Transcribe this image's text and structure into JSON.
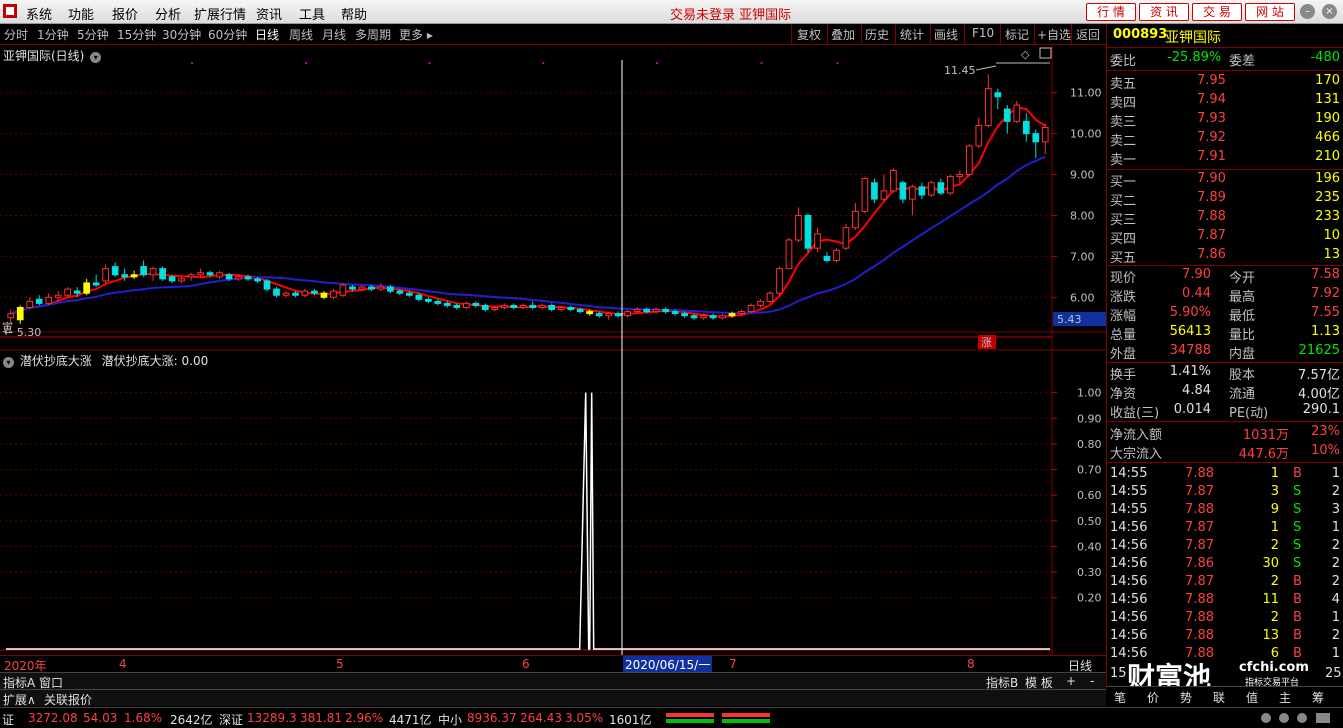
{
  "menubar": {
    "items": [
      "系统",
      "功能",
      "报价",
      "分析",
      "扩展行情",
      "资讯",
      "工具",
      "帮助"
    ],
    "status_title": "交易未登录 亚钾国际",
    "buttons": [
      "行 情",
      "资 讯",
      "交 易",
      "网 站"
    ]
  },
  "toolbar": {
    "periods": [
      "分时",
      "1分钟",
      "5分钟",
      "15分钟",
      "30分钟",
      "60分钟",
      "日线",
      "周线",
      "月线",
      "多周期",
      "更多 ▸"
    ],
    "active_period": "日线",
    "tools": [
      "复权",
      "叠加",
      "历史",
      "统计",
      "画线",
      "F10",
      "标记",
      "+自选",
      "返回"
    ]
  },
  "chart": {
    "title": "亚钾国际(日线)",
    "y_ticks": [
      "11.00",
      "10.00",
      "9.00",
      "8.00",
      "7.00",
      "6.00"
    ],
    "current_price_tag": "5.43",
    "high_annotation": "11.45",
    "low_annotation": "← 5.30",
    "overlay_text": "寅",
    "rise_marker": "涨",
    "x_labels": [
      "2020年",
      "4",
      "5",
      "6",
      "7",
      "8"
    ],
    "cursor_date": "2020/06/15/一",
    "period_label": "日线"
  },
  "indicator": {
    "title": "潜伏抄底大涨",
    "value_text": "潜伏抄底大涨: 0.00",
    "y_ticks": [
      "1.00",
      "0.90",
      "0.80",
      "0.70",
      "0.60",
      "0.50",
      "0.40",
      "0.30",
      "0.20"
    ]
  },
  "quote": {
    "code": "000893",
    "name": "亚钾国际",
    "weibi_label": "委比",
    "weibi": "-25.89%",
    "weicha_label": "委差",
    "weicha": "-480",
    "asks": [
      {
        "label": "卖五",
        "price": "7.95",
        "vol": "170"
      },
      {
        "label": "卖四",
        "price": "7.94",
        "vol": "131"
      },
      {
        "label": "卖三",
        "price": "7.93",
        "vol": "190"
      },
      {
        "label": "卖二",
        "price": "7.92",
        "vol": "466"
      },
      {
        "label": "卖一",
        "price": "7.91",
        "vol": "210"
      }
    ],
    "bids": [
      {
        "label": "买一",
        "price": "7.90",
        "vol": "196"
      },
      {
        "label": "买二",
        "price": "7.89",
        "vol": "235"
      },
      {
        "label": "买三",
        "price": "7.88",
        "vol": "233"
      },
      {
        "label": "买四",
        "price": "7.87",
        "vol": "10"
      },
      {
        "label": "买五",
        "price": "7.86",
        "vol": "13"
      }
    ],
    "stats": [
      {
        "l1": "现价",
        "v1": "7.90",
        "l2": "今开",
        "v2": "7.58"
      },
      {
        "l1": "涨跌",
        "v1": "0.44",
        "l2": "最高",
        "v2": "7.92"
      },
      {
        "l1": "涨幅",
        "v1": "5.90%",
        "l2": "最低",
        "v2": "7.55"
      },
      {
        "l1": "总量",
        "v1": "56413",
        "l2": "量比",
        "v2": "1.13"
      },
      {
        "l1": "外盘",
        "v1": "34788",
        "l2": "内盘",
        "v2": "21625"
      }
    ],
    "fund": [
      {
        "l1": "换手",
        "v1": "1.41%",
        "l2": "股本",
        "v2": "7.57亿"
      },
      {
        "l1": "净资",
        "v1": "4.84",
        "l2": "流通",
        "v2": "4.00亿"
      },
      {
        "l1": "收益(三)",
        "v1": "0.014",
        "l2": "PE(动)",
        "v2": "290.1"
      }
    ],
    "flows": [
      {
        "label": "净流入额",
        "value": "1031万",
        "pct": "23%"
      },
      {
        "label": "大宗流入",
        "value": "447.6万",
        "pct": "10%"
      }
    ],
    "ticks": [
      {
        "t": "14:55",
        "p": "7.88",
        "v": "1",
        "s": "B",
        "n": "1"
      },
      {
        "t": "14:55",
        "p": "7.87",
        "v": "3",
        "s": "S",
        "n": "2"
      },
      {
        "t": "14:55",
        "p": "7.88",
        "v": "9",
        "s": "S",
        "n": "3"
      },
      {
        "t": "14:56",
        "p": "7.87",
        "v": "1",
        "s": "S",
        "n": "1"
      },
      {
        "t": "14:56",
        "p": "7.87",
        "v": "2",
        "s": "S",
        "n": "2"
      },
      {
        "t": "14:56",
        "p": "7.86",
        "v": "30",
        "s": "S",
        "n": "2"
      },
      {
        "t": "14:56",
        "p": "7.87",
        "v": "2",
        "s": "B",
        "n": "2"
      },
      {
        "t": "14:56",
        "p": "7.88",
        "v": "11",
        "s": "B",
        "n": "4"
      },
      {
        "t": "14:56",
        "p": "7.88",
        "v": "2",
        "s": "B",
        "n": "1"
      },
      {
        "t": "14:56",
        "p": "7.88",
        "v": "13",
        "s": "B",
        "n": "2"
      },
      {
        "t": "14:56",
        "p": "7.88",
        "v": "6",
        "s": "B",
        "n": "1"
      }
    ],
    "last_tick_time": "15",
    "last_tick_n": "25",
    "bottom_tabs": [
      "笔",
      "价",
      "势",
      "联",
      "值",
      "主",
      "筹"
    ],
    "watermark": "财富池",
    "watermark_sub": "cfchi.com",
    "watermark_caption": "指标交易平台"
  },
  "tabs": {
    "row1": [
      "指标A",
      "窗口"
    ],
    "row1_right": [
      "指标B",
      "模 板",
      "+",
      "-"
    ],
    "row2": [
      "扩展∧",
      "关联报价"
    ]
  },
  "index_bar": [
    {
      "name": "证",
      "price": "3272.08",
      "chg": "54.03",
      "pct": "1.68%",
      "amt": "2642亿"
    },
    {
      "name": "深证",
      "price": "13289.3",
      "chg": "381.81",
      "pct": "2.96%",
      "amt": "4471亿"
    },
    {
      "name": "中小",
      "price": "8936.37",
      "chg": "264.43",
      "pct": "3.05%",
      "amt": "1601亿"
    }
  ],
  "chart_data": {
    "type": "candlestick",
    "candles": [
      {
        "o": 5.5,
        "c": 5.6,
        "h": 5.7,
        "l": 5.35
      },
      {
        "o": 5.45,
        "c": 5.75,
        "h": 5.8,
        "l": 5.35
      },
      {
        "o": 5.75,
        "c": 5.9,
        "h": 6.0,
        "l": 5.7
      },
      {
        "o": 5.95,
        "c": 5.85,
        "h": 6.05,
        "l": 5.8
      },
      {
        "o": 5.85,
        "c": 6.0,
        "h": 6.1,
        "l": 5.8
      },
      {
        "o": 6.0,
        "c": 6.05,
        "h": 6.15,
        "l": 5.9
      },
      {
        "o": 6.05,
        "c": 6.2,
        "h": 6.25,
        "l": 6.0
      },
      {
        "o": 6.15,
        "c": 6.1,
        "h": 6.25,
        "l": 6.0
      },
      {
        "o": 6.1,
        "c": 6.35,
        "h": 6.45,
        "l": 6.05
      },
      {
        "o": 6.35,
        "c": 6.3,
        "h": 6.55,
        "l": 6.25
      },
      {
        "o": 6.4,
        "c": 6.7,
        "h": 6.8,
        "l": 6.35
      },
      {
        "o": 6.75,
        "c": 6.55,
        "h": 6.85,
        "l": 6.5
      },
      {
        "o": 6.55,
        "c": 6.5,
        "h": 6.7,
        "l": 6.4
      },
      {
        "o": 6.5,
        "c": 6.55,
        "h": 6.65,
        "l": 6.45
      },
      {
        "o": 6.75,
        "c": 6.55,
        "h": 6.9,
        "l": 6.5
      },
      {
        "o": 6.55,
        "c": 6.7,
        "h": 6.75,
        "l": 6.4
      },
      {
        "o": 6.7,
        "c": 6.45,
        "h": 6.75,
        "l": 6.4
      },
      {
        "o": 6.5,
        "c": 6.4,
        "h": 6.55,
        "l": 6.35
      },
      {
        "o": 6.4,
        "c": 6.45,
        "h": 6.5,
        "l": 6.35
      },
      {
        "o": 6.5,
        "c": 6.55,
        "h": 6.6,
        "l": 6.4
      },
      {
        "o": 6.55,
        "c": 6.6,
        "h": 6.7,
        "l": 6.5
      },
      {
        "o": 6.6,
        "c": 6.55,
        "h": 6.65,
        "l": 6.5
      },
      {
        "o": 6.5,
        "c": 6.6,
        "h": 6.65,
        "l": 6.45
      },
      {
        "o": 6.55,
        "c": 6.45,
        "h": 6.6,
        "l": 6.4
      },
      {
        "o": 6.45,
        "c": 6.5,
        "h": 6.55,
        "l": 6.4
      },
      {
        "o": 6.5,
        "c": 6.45,
        "h": 6.55,
        "l": 6.4
      },
      {
        "o": 6.45,
        "c": 6.4,
        "h": 6.5,
        "l": 6.35
      },
      {
        "o": 6.4,
        "c": 6.2,
        "h": 6.45,
        "l": 6.15
      },
      {
        "o": 6.2,
        "c": 6.05,
        "h": 6.25,
        "l": 6.0
      },
      {
        "o": 6.05,
        "c": 6.1,
        "h": 6.15,
        "l": 6.0
      },
      {
        "o": 6.1,
        "c": 6.05,
        "h": 6.15,
        "l": 6.0
      },
      {
        "o": 6.05,
        "c": 6.15,
        "h": 6.2,
        "l": 6.0
      },
      {
        "o": 6.15,
        "c": 6.1,
        "h": 6.2,
        "l": 6.05
      },
      {
        "o": 6.1,
        "c": 6.0,
        "h": 6.15,
        "l": 5.95
      },
      {
        "o": 6.0,
        "c": 6.15,
        "h": 6.2,
        "l": 5.95
      },
      {
        "o": 6.05,
        "c": 6.3,
        "h": 6.35,
        "l": 6.0
      },
      {
        "o": 6.25,
        "c": 6.2,
        "h": 6.3,
        "l": 6.15
      },
      {
        "o": 6.2,
        "c": 6.25,
        "h": 6.3,
        "l": 6.15
      },
      {
        "o": 6.25,
        "c": 6.2,
        "h": 6.3,
        "l": 6.15
      },
      {
        "o": 6.2,
        "c": 6.25,
        "h": 6.35,
        "l": 6.15
      },
      {
        "o": 6.25,
        "c": 6.15,
        "h": 6.3,
        "l": 6.1
      },
      {
        "o": 6.15,
        "c": 6.1,
        "h": 6.2,
        "l": 6.05
      },
      {
        "o": 6.1,
        "c": 6.05,
        "h": 6.15,
        "l": 6.0
      },
      {
        "o": 6.05,
        "c": 5.95,
        "h": 6.1,
        "l": 5.9
      },
      {
        "o": 5.95,
        "c": 5.9,
        "h": 6.0,
        "l": 5.85
      },
      {
        "o": 5.9,
        "c": 5.85,
        "h": 5.95,
        "l": 5.8
      },
      {
        "o": 5.85,
        "c": 5.8,
        "h": 5.9,
        "l": 5.75
      },
      {
        "o": 5.8,
        "c": 5.75,
        "h": 5.85,
        "l": 5.7
      },
      {
        "o": 5.75,
        "c": 5.85,
        "h": 5.9,
        "l": 5.7
      },
      {
        "o": 5.85,
        "c": 5.8,
        "h": 5.9,
        "l": 5.75
      },
      {
        "o": 5.8,
        "c": 5.7,
        "h": 5.85,
        "l": 5.65
      },
      {
        "o": 5.7,
        "c": 5.75,
        "h": 5.8,
        "l": 5.65
      },
      {
        "o": 5.75,
        "c": 5.8,
        "h": 5.85,
        "l": 5.7
      },
      {
        "o": 5.8,
        "c": 5.75,
        "h": 5.85,
        "l": 5.7
      },
      {
        "o": 5.75,
        "c": 5.8,
        "h": 5.85,
        "l": 5.7
      },
      {
        "o": 5.8,
        "c": 5.75,
        "h": 5.9,
        "l": 5.7
      },
      {
        "o": 5.75,
        "c": 5.8,
        "h": 5.85,
        "l": 5.7
      },
      {
        "o": 5.8,
        "c": 5.7,
        "h": 5.85,
        "l": 5.65
      },
      {
        "o": 5.7,
        "c": 5.75,
        "h": 5.8,
        "l": 5.65
      },
      {
        "o": 5.75,
        "c": 5.7,
        "h": 5.8,
        "l": 5.65
      },
      {
        "o": 5.7,
        "c": 5.65,
        "h": 5.75,
        "l": 5.6
      },
      {
        "o": 5.65,
        "c": 5.6,
        "h": 5.7,
        "l": 5.55
      },
      {
        "o": 5.6,
        "c": 5.55,
        "h": 5.65,
        "l": 5.5
      },
      {
        "o": 5.55,
        "c": 5.6,
        "h": 5.65,
        "l": 5.45
      },
      {
        "o": 5.6,
        "c": 5.55,
        "h": 5.65,
        "l": 5.5
      },
      {
        "o": 5.55,
        "c": 5.65,
        "h": 5.7,
        "l": 5.5
      },
      {
        "o": 5.65,
        "c": 5.7,
        "h": 5.75,
        "l": 5.6
      },
      {
        "o": 5.7,
        "c": 5.65,
        "h": 5.75,
        "l": 5.6
      },
      {
        "o": 5.65,
        "c": 5.7,
        "h": 5.75,
        "l": 5.6
      },
      {
        "o": 5.7,
        "c": 5.65,
        "h": 5.75,
        "l": 5.6
      },
      {
        "o": 5.65,
        "c": 5.6,
        "h": 5.7,
        "l": 5.55
      },
      {
        "o": 5.6,
        "c": 5.55,
        "h": 5.65,
        "l": 5.5
      },
      {
        "o": 5.55,
        "c": 5.5,
        "h": 5.6,
        "l": 5.45
      },
      {
        "o": 5.5,
        "c": 5.55,
        "h": 5.6,
        "l": 5.45
      },
      {
        "o": 5.55,
        "c": 5.5,
        "h": 5.6,
        "l": 5.45
      },
      {
        "o": 5.5,
        "c": 5.55,
        "h": 5.6,
        "l": 5.45
      },
      {
        "o": 5.55,
        "c": 5.6,
        "h": 5.65,
        "l": 5.5
      },
      {
        "o": 5.6,
        "c": 5.65,
        "h": 5.7,
        "l": 5.55
      },
      {
        "o": 5.65,
        "c": 5.8,
        "h": 5.85,
        "l": 5.6
      },
      {
        "o": 5.8,
        "c": 5.9,
        "h": 5.95,
        "l": 5.75
      },
      {
        "o": 5.9,
        "c": 6.1,
        "h": 6.15,
        "l": 5.85
      },
      {
        "o": 6.1,
        "c": 6.7,
        "h": 6.75,
        "l": 6.05
      },
      {
        "o": 6.7,
        "c": 7.4,
        "h": 7.45,
        "l": 6.7
      },
      {
        "o": 7.4,
        "c": 8.0,
        "h": 8.2,
        "l": 7.35
      },
      {
        "o": 8.0,
        "c": 7.2,
        "h": 8.05,
        "l": 7.1
      },
      {
        "o": 7.2,
        "c": 7.55,
        "h": 7.7,
        "l": 7.1
      },
      {
        "o": 7.0,
        "c": 6.9,
        "h": 7.1,
        "l": 6.85
      },
      {
        "o": 6.9,
        "c": 7.15,
        "h": 7.2,
        "l": 6.85
      },
      {
        "o": 7.2,
        "c": 7.7,
        "h": 7.8,
        "l": 7.15
      },
      {
        "o": 7.7,
        "c": 8.1,
        "h": 8.3,
        "l": 7.65
      },
      {
        "o": 8.1,
        "c": 8.9,
        "h": 8.95,
        "l": 8.05
      },
      {
        "o": 8.8,
        "c": 8.4,
        "h": 8.9,
        "l": 8.3
      },
      {
        "o": 8.4,
        "c": 8.6,
        "h": 9.0,
        "l": 8.35
      },
      {
        "o": 8.6,
        "c": 9.1,
        "h": 9.15,
        "l": 8.55
      },
      {
        "o": 8.8,
        "c": 8.4,
        "h": 8.85,
        "l": 8.3
      },
      {
        "o": 8.4,
        "c": 8.7,
        "h": 8.75,
        "l": 8.0
      },
      {
        "o": 8.7,
        "c": 8.5,
        "h": 8.8,
        "l": 8.4
      },
      {
        "o": 8.5,
        "c": 8.8,
        "h": 8.85,
        "l": 8.45
      },
      {
        "o": 8.8,
        "c": 8.55,
        "h": 8.9,
        "l": 8.5
      },
      {
        "o": 8.55,
        "c": 8.95,
        "h": 9.0,
        "l": 8.5
      },
      {
        "o": 8.95,
        "c": 9.0,
        "h": 9.1,
        "l": 8.8
      },
      {
        "o": 9.0,
        "c": 9.7,
        "h": 9.75,
        "l": 8.95
      },
      {
        "o": 9.7,
        "c": 10.2,
        "h": 10.4,
        "l": 9.65
      },
      {
        "o": 10.2,
        "c": 11.1,
        "h": 11.45,
        "l": 10.15
      },
      {
        "o": 11.0,
        "c": 10.9,
        "h": 11.1,
        "l": 10.6
      },
      {
        "o": 10.6,
        "c": 10.3,
        "h": 10.7,
        "l": 10.0
      },
      {
        "o": 10.3,
        "c": 10.7,
        "h": 10.8,
        "l": 10.25
      },
      {
        "o": 10.3,
        "c": 10.0,
        "h": 10.5,
        "l": 9.8
      },
      {
        "o": 10.0,
        "c": 9.8,
        "h": 10.1,
        "l": 9.4
      },
      {
        "o": 9.8,
        "c": 10.15,
        "h": 10.25,
        "l": 9.5
      }
    ],
    "ylim": [
      5.2,
      11.8
    ],
    "indicator_signal_index": 61,
    "indicator_ylim": [
      0,
      1.1
    ],
    "ma_fast_color": "#ff0000",
    "ma_slow_color": "#2020d0",
    "up_color": "#ff3030",
    "down_color": "#00e0e0",
    "signal_color": "#ffff00"
  }
}
